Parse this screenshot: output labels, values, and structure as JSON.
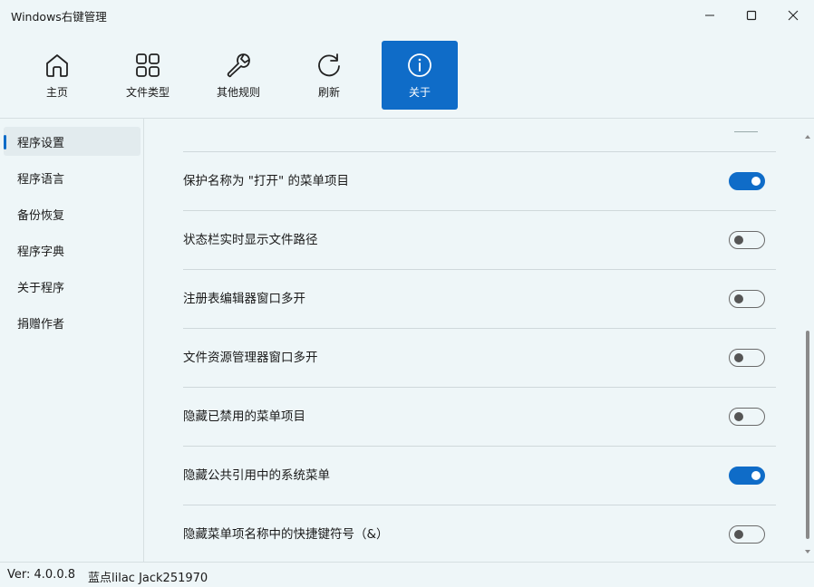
{
  "window": {
    "title": "Windows右键管理"
  },
  "toolbar": {
    "items": [
      {
        "label": "主页",
        "icon": "home-icon"
      },
      {
        "label": "文件类型",
        "icon": "grid-icon"
      },
      {
        "label": "其他规则",
        "icon": "wrench-icon"
      },
      {
        "label": "刷新",
        "icon": "refresh-icon"
      },
      {
        "label": "关于",
        "icon": "info-icon",
        "active": true
      }
    ]
  },
  "sidebar": {
    "items": [
      {
        "label": "程序设置",
        "active": true
      },
      {
        "label": "程序语言"
      },
      {
        "label": "备份恢复"
      },
      {
        "label": "程序字典"
      },
      {
        "label": "关于程序"
      },
      {
        "label": "捐赠作者"
      }
    ]
  },
  "settings": {
    "rows": [
      {
        "label": "保护名称为 \"打开\" 的菜单项目",
        "on": true
      },
      {
        "label": "状态栏实时显示文件路径",
        "on": false
      },
      {
        "label": "注册表编辑器窗口多开",
        "on": false
      },
      {
        "label": "文件资源管理器窗口多开",
        "on": false
      },
      {
        "label": "隐藏已禁用的菜单项目",
        "on": false
      },
      {
        "label": "隐藏公共引用中的系统菜单",
        "on": true
      },
      {
        "label": "隐藏菜单项名称中的快捷键符号（&）",
        "on": false
      }
    ]
  },
  "statusbar": {
    "version": "Ver: 4.0.0.8",
    "author": "蓝点lilac Jack251970"
  },
  "colors": {
    "accent": "#0f6cc8",
    "background": "#eef6f8"
  }
}
